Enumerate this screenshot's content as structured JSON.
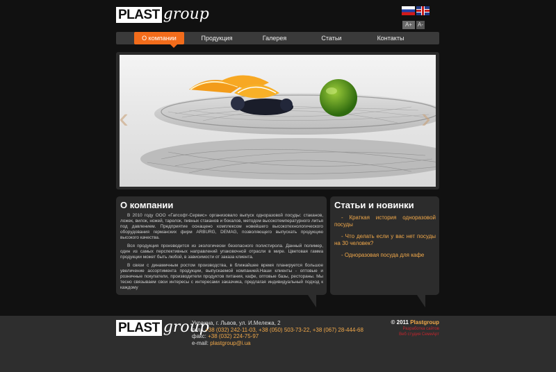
{
  "header": {
    "logo_plast": "PLAST",
    "logo_group": "group",
    "flags": [
      "ru-flag-icon",
      "en-flag-icon"
    ],
    "font_controls": {
      "increase": "A+",
      "decrease": "A-"
    }
  },
  "nav": {
    "items": [
      "О компании",
      "Продукция",
      "Галерея",
      "Статьи",
      "Контакты"
    ],
    "active_index": 0
  },
  "slider": {
    "prev_icon": "chevron-left-icon",
    "next_icon": "chevron-right-icon",
    "prev_glyph": "‹",
    "next_glyph": "›"
  },
  "about": {
    "title": "О компании",
    "paragraphs": [
      "В 2010 году ООО «Гапсофт-Сервис» организовало выпуск одноразовой посуды: стаканов, ложек, вилок, ножей, тарелок, пивных стаканов и бокалов, методом высокотемпературного литья под давлением. Предприятие оснащено комплексом новейшего высокотехнологического оборудования германских фирм ARBURG, DEMAG, позволяющего выпускать продукцию высокого качества.",
      "Вся продукция производится из экологически безопасного полистирола. Данный полимер, один из самых перспективных направлений упаковочной отрасли в мире. Цветовая гамма продукции может быть любой, в зависимости от заказа клиента.",
      "В связи с динамичным ростом производства, в ближайшее время планируется большое увеличение ассортимента продукции, выпускаемой компанией.Наши клиенты - оптовые и розничные покупатели, производители продуктов питания, кафе, оптовые базы, рестораны. Мы тесно связываем свои интересы с интересами заказчика, предлагая индивидуальный подход к каждому"
    ]
  },
  "news": {
    "title": "Статьи и новинки",
    "items": [
      "- Краткая история одноразовой посуды",
      "- Что делать если у вас нет посуды на 30 человек?",
      "- Одноразовая посуда для кафе"
    ]
  },
  "footer": {
    "address": "Украина, г. Львов, ул. И.Мележа, 2",
    "phone_label": "тел.:",
    "phones": "+38 (032) 242-11-03, +38 (050) 503-73-22, +38 (067) 28-444-68",
    "fax_label": "факс:",
    "fax": "+38 (032) 224-75-97",
    "email_label": "e-mail:",
    "email": "plastgroup@i.ua",
    "copyright": "© 2011",
    "brand": "Plastgroup",
    "credit_1": "Разработка сайтов",
    "credit_2": "Веб студия СемиАрт"
  }
}
